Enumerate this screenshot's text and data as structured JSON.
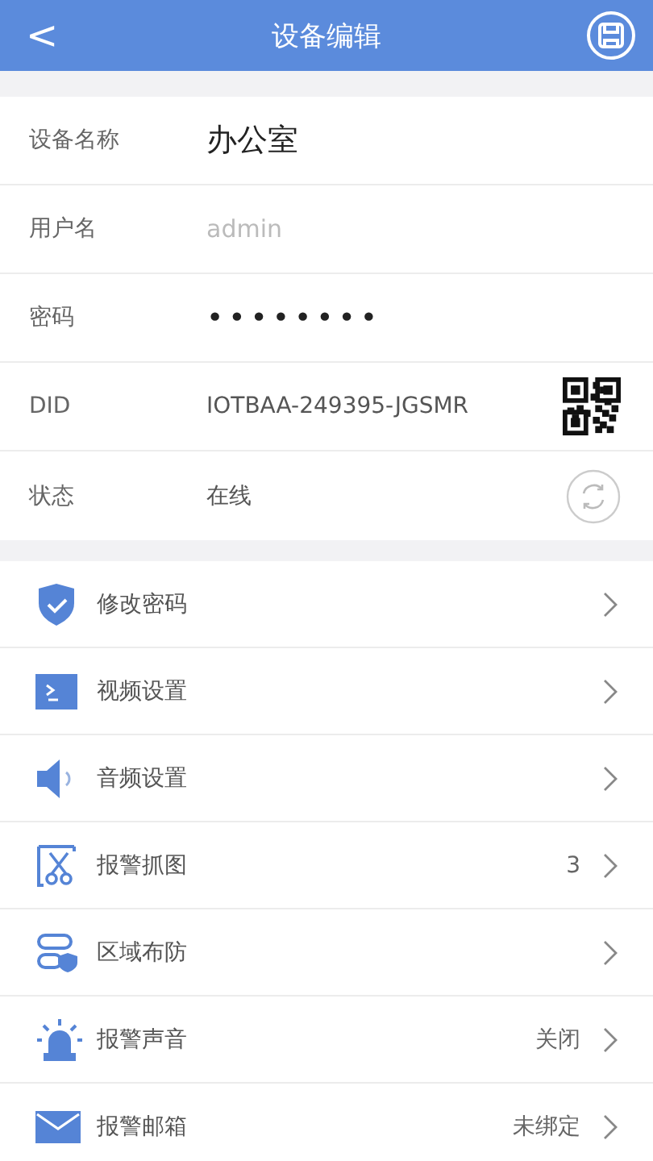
{
  "header": {
    "back": "<",
    "title": "设备编辑"
  },
  "fields": [
    {
      "kind": "text",
      "label": "设备名称",
      "value": "办公室"
    },
    {
      "kind": "input",
      "label": "用户名",
      "placeholder": "admin"
    },
    {
      "kind": "password",
      "label": "密码",
      "value": "••••••••"
    },
    {
      "kind": "qr",
      "label": "DID",
      "value": "IOTBAA-249395-JGSMR"
    },
    {
      "kind": "refresh",
      "label": "状态",
      "value": "在线"
    }
  ],
  "menu": [
    {
      "kind": "shield",
      "label": "修改密码"
    },
    {
      "kind": "video",
      "label": "视频设置"
    },
    {
      "kind": "audio",
      "label": "音频设置"
    },
    {
      "kind": "snapshot",
      "label": "报警抓图",
      "value": "3"
    },
    {
      "kind": "zone",
      "label": "区域布防"
    },
    {
      "kind": "siren",
      "label": "报警声音",
      "value": "关闭"
    },
    {
      "kind": "mail",
      "label": "报警邮箱",
      "value": "未绑定"
    }
  ]
}
